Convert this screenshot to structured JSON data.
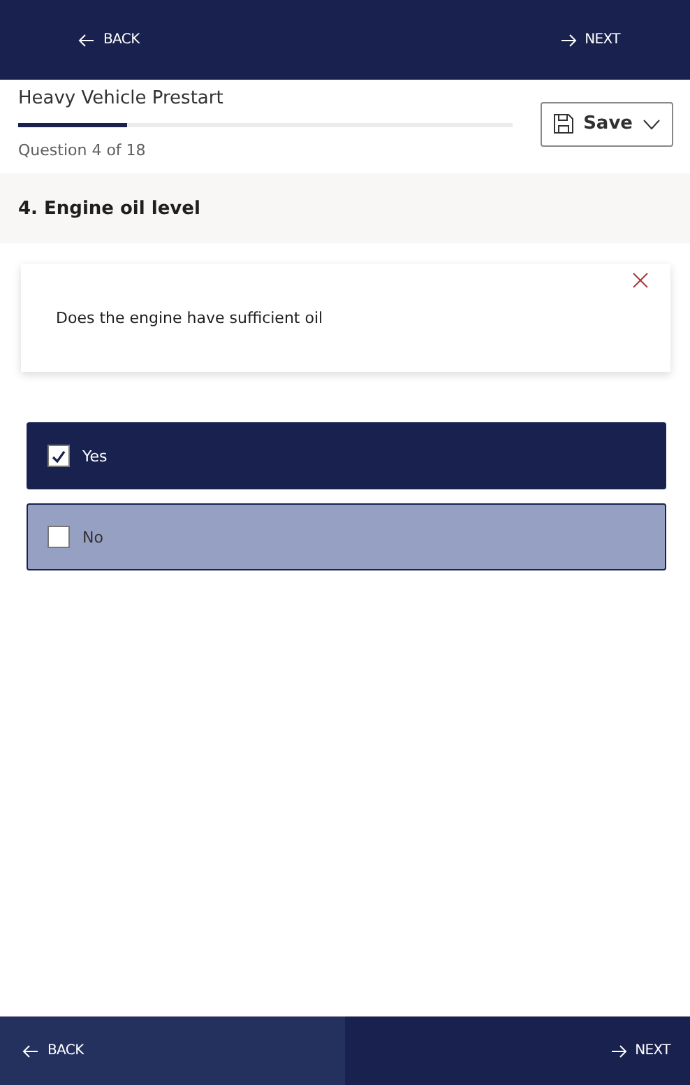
{
  "top_nav": [
    {
      "kind": "back",
      "label": "BACK"
    },
    {
      "kind": "next",
      "label": "NEXT"
    }
  ],
  "header": {
    "title": "Heavy Vehicle Prestart",
    "level": 0.22,
    "progress_text": "Question 4 of 18",
    "save_label": "Save"
  },
  "section": {
    "title": "4. Engine oil level"
  },
  "card": {
    "question": "Does the engine have sufficient oil"
  },
  "options": [
    {
      "label": "Yes",
      "checked": true,
      "selected": true
    },
    {
      "label": "No",
      "checked": false,
      "selected": false
    }
  ],
  "bottom_nav": [
    {
      "kind": "back",
      "label": "BACK",
      "hovered": true
    },
    {
      "kind": "next",
      "label": "NEXT",
      "hovered": false
    }
  ]
}
